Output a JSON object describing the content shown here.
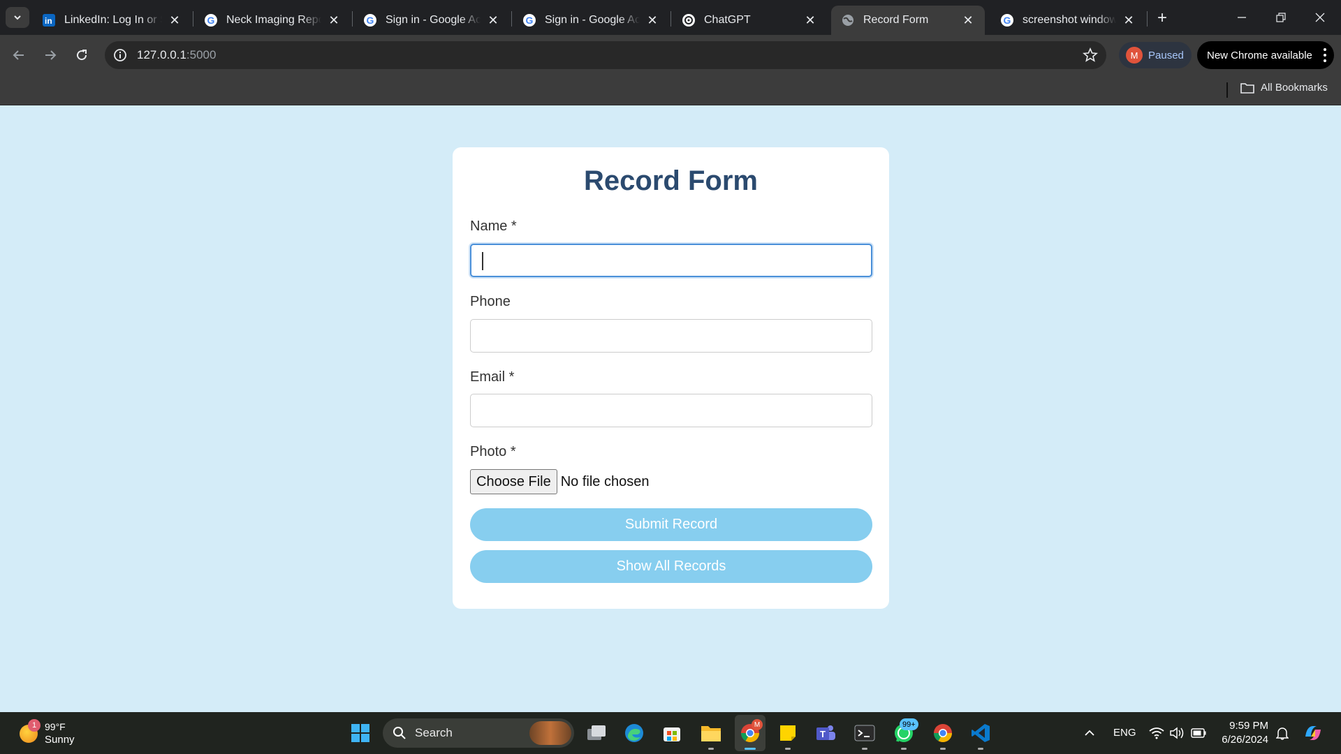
{
  "browser": {
    "tabs": [
      {
        "title": "LinkedIn: Log In or Sign Up",
        "favicon": "linkedin-icon"
      },
      {
        "title": "Neck Imaging Report",
        "favicon": "google-icon"
      },
      {
        "title": "Sign in - Google Accounts",
        "favicon": "google-icon"
      },
      {
        "title": "Sign in - Google Accounts",
        "favicon": "google-icon"
      },
      {
        "title": "ChatGPT",
        "favicon": "chatgpt-icon"
      },
      {
        "title": "Record Form",
        "favicon": "globe-icon",
        "active": true
      },
      {
        "title": "screenshot windows",
        "favicon": "google-icon"
      }
    ],
    "url_host": "127.0.0.1",
    "url_port": ":5000",
    "profile_initial": "M",
    "profile_status": "Paused",
    "update_label": "New Chrome available",
    "all_bookmarks_label": "All Bookmarks"
  },
  "form": {
    "title": "Record Form",
    "name_label": "Name *",
    "phone_label": "Phone",
    "email_label": "Email *",
    "photo_label": "Photo *",
    "name_value": "",
    "phone_value": "",
    "email_value": "",
    "choose_file_label": "Choose File",
    "file_status": "No file chosen",
    "submit_label": "Submit Record",
    "show_all_label": "Show All Records",
    "button_color": "#87ceef",
    "title_color": "#2b4a6f",
    "background_color": "#d4ecf8"
  },
  "taskbar": {
    "weather_badge": "1",
    "temperature": "99°F",
    "condition": "Sunny",
    "search_label": "Search",
    "chrome_badge": "M",
    "whatsapp_badge": "99+",
    "language": "ENG",
    "time": "9:59 PM",
    "date": "6/26/2024"
  }
}
